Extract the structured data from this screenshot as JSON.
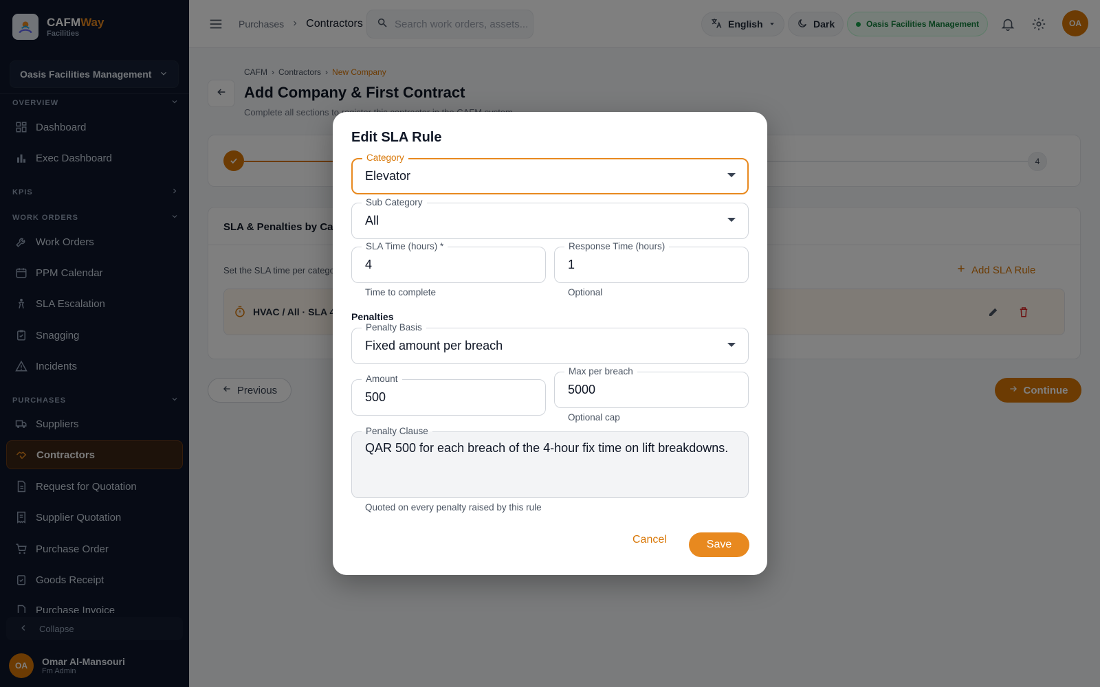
{
  "brand": {
    "name_a": "CAFM",
    "name_b": "Way",
    "subtitle": "Facilities"
  },
  "sidebar": {
    "org": "Oasis Facilities Management",
    "sections": {
      "overview": "OVERVIEW",
      "kpis": "KPIS",
      "work_orders": "WORK ORDERS",
      "purchases": "PURCHASES"
    },
    "items": {
      "dashboard": "Dashboard",
      "exec_dashboard": "Exec Dashboard",
      "work_orders": "Work Orders",
      "ppm_calendar": "PPM Calendar",
      "sla_escalation": "SLA Escalation",
      "snagging": "Snagging",
      "incidents": "Incidents",
      "suppliers": "Suppliers",
      "contractors": "Contractors",
      "rfq": "Request for Quotation",
      "supplier_quotation": "Supplier Quotation",
      "purchase_order": "Purchase Order",
      "goods_receipt": "Goods Receipt",
      "purchase_invoice": "Purchase Invoice"
    },
    "collapse": "Collapse",
    "user": {
      "initials": "OA",
      "name": "Omar Al-Mansouri",
      "role": "Fm Admin"
    }
  },
  "topbar": {
    "crumb_parent": "Purchases",
    "crumb_current": "Contractors",
    "search_placeholder": "Search work orders, assets...",
    "language": "English",
    "theme": "Dark",
    "org": "Oasis Facilities Management",
    "avatar_initials": "OA"
  },
  "page": {
    "crumbs": [
      "CAFM",
      "Contractors",
      "New Company"
    ],
    "title": "Add Company & First Contract",
    "subtitle": "Complete all sections to register this contractor in the CAFM system",
    "step_last": "4",
    "sla_card_title": "SLA & Penalties by Category",
    "sla_card_desc": "Set the SLA time per category",
    "add_rule": "Add SLA Rule",
    "rule_row": "HVAC / All · SLA 4h",
    "previous": "Previous",
    "continue": "Continue"
  },
  "modal": {
    "title": "Edit SLA Rule",
    "category": {
      "label": "Category",
      "value": "Elevator"
    },
    "sub_category": {
      "label": "Sub Category",
      "value": "All"
    },
    "sla_time": {
      "label": "SLA Time (hours) *",
      "value": "4",
      "helper": "Time to complete"
    },
    "response_time": {
      "label": "Response Time (hours)",
      "value": "1",
      "helper": "Optional"
    },
    "penalties_label": "Penalties",
    "penalty_basis": {
      "label": "Penalty Basis",
      "value": "Fixed amount per breach"
    },
    "amount": {
      "label": "Amount",
      "value": "500"
    },
    "max_per_breach": {
      "label": "Max per breach",
      "value": "5000",
      "helper": "Optional cap"
    },
    "penalty_clause": {
      "label": "Penalty Clause",
      "value": "QAR 500 for each breach of the 4-hour fix time on lift breakdowns.",
      "helper": "Quoted on every penalty raised by this rule"
    },
    "cancel": "Cancel",
    "save": "Save"
  },
  "colors": {
    "accent": "#e8891f",
    "sidebar_bg": "#0f172a",
    "danger": "#dc2626",
    "success": "#16a34a"
  }
}
